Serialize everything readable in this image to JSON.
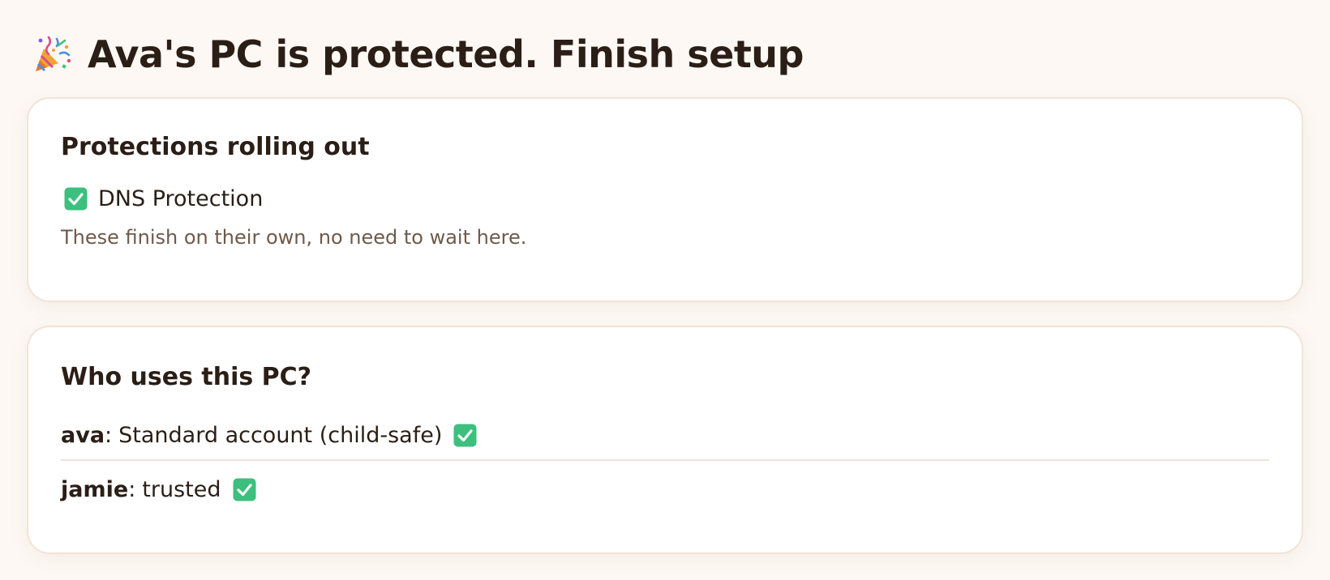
{
  "header": {
    "icon": "party-popper-icon",
    "title": "Ava's PC is protected. Finish setup"
  },
  "protections": {
    "title": "Protections rolling out",
    "items": [
      {
        "icon": "check-icon",
        "label": "DNS Protection"
      }
    ],
    "note": "These finish on their own, no need to wait here."
  },
  "users": {
    "title": "Who uses this PC?",
    "separator": ":",
    "items": [
      {
        "name": "ava",
        "role": "Standard account (child-safe)",
        "icon": "check-icon"
      },
      {
        "name": "jamie",
        "role": "trusted",
        "icon": "check-icon"
      }
    ]
  },
  "colors": {
    "background": "#fdf8f4",
    "card": "#ffffff",
    "card_border": "#f2e3d6",
    "text": "#2a1e16",
    "muted_text": "#6e5a4b",
    "check_green": "#3dbf7e"
  }
}
